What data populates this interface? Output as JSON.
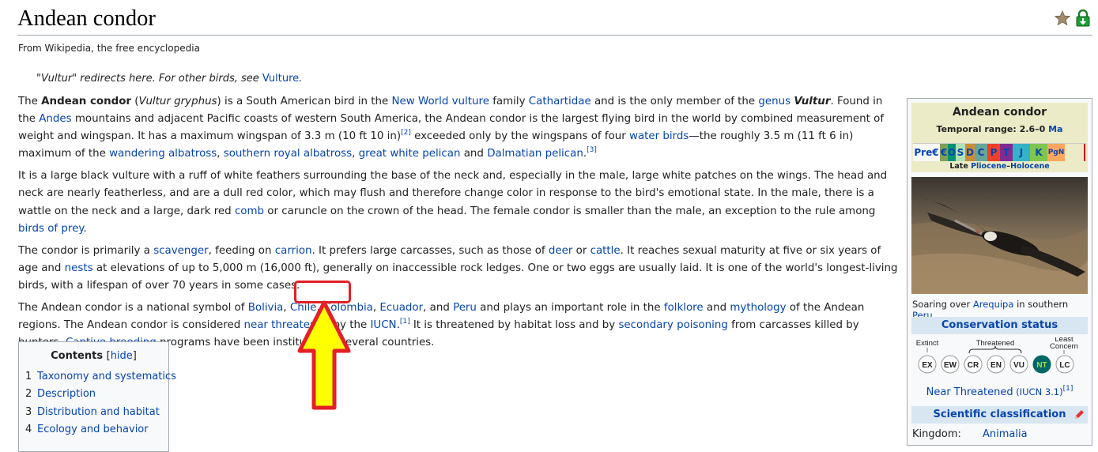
{
  "title": "Andean condor",
  "site_sub": "From Wikipedia, the free encyclopedia",
  "hatnote": {
    "prefix": "\"Vultur\" redirects here. For other birds, see ",
    "link": "Vulture",
    "suffix": "."
  },
  "icons": {
    "star": "star-icon",
    "lock": "green-lock-icon",
    "pencil": "pencil-icon"
  },
  "p1": {
    "t1": "The ",
    "b1": "Andean condor",
    "t2": " (",
    "i1": "Vultur gryphus",
    "t3": ") is a South American bird in the ",
    "l1": "New World vulture",
    "t4": " family ",
    "l2": "Cathartidae",
    "t5": " and is the only member of the ",
    "l3": "genus",
    "t6": " ",
    "bi1": "Vultur",
    "t7": ". Found in the ",
    "l4": "Andes",
    "t8": " mountains and adjacent Pacific coasts of western South America, the Andean condor is the largest flying bird in the world by combined measurement of weight and wingspan. It has a maximum wingspan of 3.3 m (10 ft 10 in)",
    "s1": "[2]",
    "t9": " exceeded only by the wingspans of four ",
    "l5": "water birds",
    "t10": "—the roughly 3.5 m (11 ft 6 in) maximum of the ",
    "l6": "wandering albatross",
    "t11": ", ",
    "l7": "southern royal albatross",
    "t12": ", ",
    "l8": "great white pelican",
    "t13": " and ",
    "l9": "Dalmatian pelican",
    "t14": ".",
    "s2": "[3]"
  },
  "p2": {
    "t1": "It is a large black vulture with a ruff of white feathers surrounding the base of the neck and, especially in the male, large white patches on the wings. The head and neck are nearly featherless, and are a dull red color, which may flush and therefore change color in response to the bird's emotional state. In the male, there is a wattle on the neck and a large, dark red ",
    "l1": "comb",
    "t2": " or caruncle on the crown of the head. The female condor is smaller than the male, an exception to the rule among ",
    "l2": "birds of prey",
    "t3": "."
  },
  "p3": {
    "t1": "The condor is primarily a ",
    "l1": "scavenger",
    "t2": ", feeding on ",
    "l2": "carrion",
    "t3": ". It prefers large carcasses, such as those of ",
    "l3": "deer",
    "t4": " or ",
    "l4": "cattle",
    "t5": ". It reaches sexual maturity at five or six years of age and ",
    "l5": "nests",
    "t6": " at elevations of up to 5,000 m (16,000 ft), generally on inaccessible rock ledges. One or two eggs are usually laid. It is one of the world's longest-living birds, with a lifespan of over 70 years in some cases."
  },
  "p4": {
    "t1": "The Andean condor is a national symbol of ",
    "l1": "Bolivia",
    "t2": ", ",
    "l2": "Chile",
    "t3": ", ",
    "l3": "Colombia",
    "t4": ", ",
    "l4": "Ecuador",
    "t5": ", and ",
    "l5": "Peru",
    "t6": " and plays an important role in the ",
    "l6": "folklore",
    "t7": " and ",
    "l7": "mythology",
    "t8": " of the Andean regions. The Andean condor is considered ",
    "l8": "near threatened",
    "t9": " by the ",
    "l9": "IUCN",
    "t10": ".",
    "s1": "[1]",
    "t11": " It is threatened by habitat loss and by ",
    "l10": "secondary poisoning",
    "t12": " from carcasses killed by hunters. ",
    "l11": "Captive breeding",
    "t13": " programs have been instituted in several countries."
  },
  "toc": {
    "title": "Contents",
    "hide_open": "[",
    "hide": "hide",
    "hide_close": "]",
    "items": [
      {
        "num": "1",
        "label": "Taxonomy and systematics"
      },
      {
        "num": "2",
        "label": "Description"
      },
      {
        "num": "3",
        "label": "Distribution and habitat"
      },
      {
        "num": "4",
        "label": "Ecology and behavior"
      }
    ]
  },
  "infobox": {
    "title": "Andean condor",
    "range_prefix": "Temporal range: 2.6–0 ",
    "range_unit": "Ma",
    "timescale": [
      {
        "label": "Pre€",
        "color": "#f7f7f7"
      },
      {
        "label": "€",
        "color": "#7fa056"
      },
      {
        "label": "O",
        "color": "#009270"
      },
      {
        "label": "S",
        "color": "#b3e1b6"
      },
      {
        "label": "D",
        "color": "#cb8c37"
      },
      {
        "label": "C",
        "color": "#67a599"
      },
      {
        "label": "P",
        "color": "#f04028"
      },
      {
        "label": "T",
        "color": "#812b92"
      },
      {
        "label": "J",
        "color": "#34b2c9"
      },
      {
        "label": "K",
        "color": "#7fc64e"
      },
      {
        "label": "PgN",
        "color": "#fda75f"
      }
    ],
    "epoch_prefix": "Late ",
    "epoch_l1": "Pliocene",
    "epoch_dash": "–",
    "epoch_l2": "Holocene",
    "caption_t1": "Soaring over ",
    "caption_l1": "Arequipa",
    "caption_t2": " in southern ",
    "caption_l2": "Peru",
    "caption_t3": ".",
    "conservation_head": "Conservation status",
    "cons_labels": {
      "extinct": "Extinct",
      "threatened": "Threatened",
      "least1": "Least",
      "least2": "Concern"
    },
    "cons_codes": [
      "EX",
      "EW",
      "CR",
      "EN",
      "VU",
      "NT",
      "LC"
    ],
    "cons_selected": "NT",
    "status_link": "Near Threatened",
    "status_paren": " (IUCN 3.1)",
    "status_sup": "[1]",
    "sci_head": "Scientific classification",
    "kingdom_label": "Kingdom:",
    "kingdom_value": "Animalia"
  },
  "annotation": {
    "highlight_color": "#e32026",
    "arrow_fill": "#ffff00",
    "arrow_stroke": "#e32026",
    "target": "Colombia"
  }
}
